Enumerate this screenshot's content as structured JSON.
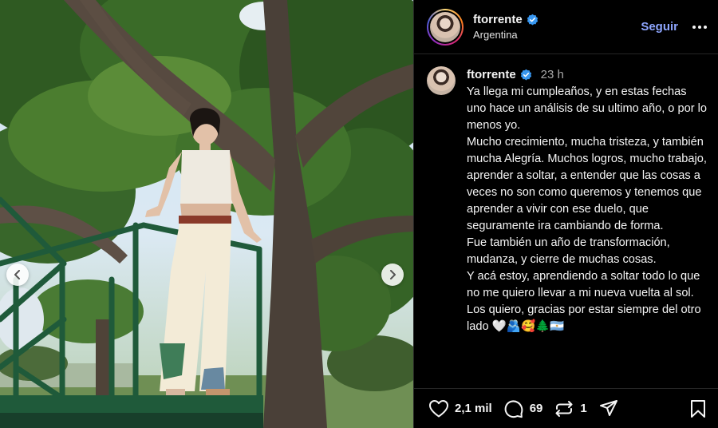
{
  "post": {
    "photo_alt": "",
    "carousel": {
      "prev_icon": "chevron-left-icon",
      "next_icon": "chevron-right-icon"
    }
  },
  "header": {
    "username": "ftorrente",
    "location": "Argentina",
    "follow_label": "Seguir",
    "verified_icon": "verified-badge-icon",
    "more_icon": "more-options-icon"
  },
  "caption": {
    "username": "ftorrente",
    "time": "23 h",
    "text": "Ya llega mi cumpleaños, y en estas fechas uno hace un análisis de su ultimo año, o por lo menos yo.\nMucho crecimiento, mucha tristeza, y también mucha Alegría. Muchos logros, mucho trabajo, aprender a soltar, a entender que las cosas a veces no son como queremos y tenemos que aprender a vivir con ese duelo, que seguramente ira cambiando de forma.\nFue también un año de transformación, mudanza, y cierre de muchas cosas.\nY acá estoy, aprendiendo a soltar todo lo que no me quiero llevar a mi nueva vuelta al sol.\nLos quiero, gracias por estar siempre del otro lado 🤍🫂🥰🌲🇦🇷"
  },
  "actions": {
    "likes": "2,1 mil",
    "comments": "69",
    "reposts": "1",
    "like_icon": "heart-icon",
    "comment_icon": "comment-icon",
    "repost_icon": "repost-icon",
    "share_icon": "share-icon",
    "save_icon": "bookmark-icon"
  },
  "colors": {
    "background": "#000000",
    "follow_link": "#8ea6ff",
    "verified": "#3897f0",
    "divider": "#262626",
    "railing": "#1f5a3a"
  }
}
